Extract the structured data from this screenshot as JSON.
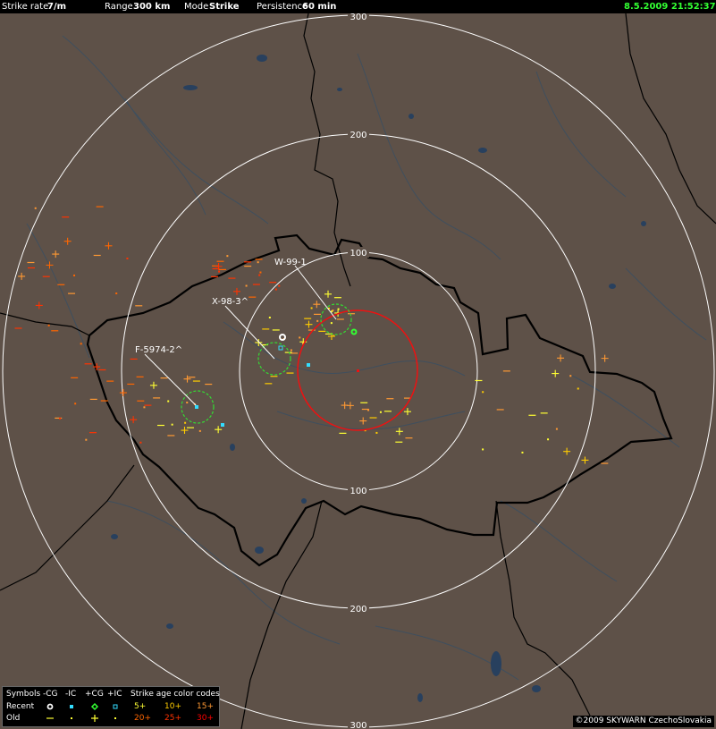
{
  "header": {
    "strike_rate_label": "Strike rate",
    "strike_rate_value": "7/m",
    "range_label": "Range",
    "range_value": "300 km",
    "mode_label": "Mode",
    "mode_value": "Strike",
    "persistence_label": "Persistence",
    "persistence_value": "60 min",
    "timestamp": "8.5.2009 21:52:37"
  },
  "rings": [
    {
      "label": "100"
    },
    {
      "label": "200"
    },
    {
      "label": "300"
    }
  ],
  "storms": [
    {
      "id": "W-99-1"
    },
    {
      "id": "X-98-3^"
    },
    {
      "id": "F-5974-2^"
    }
  ],
  "legend": {
    "symbols_label": "Symbols",
    "col_neg_cg": "-CG",
    "col_neg_ic": "-IC",
    "col_pos_cg": "+CG",
    "col_pos_ic": "+IC",
    "age_title": "Strike age color codes",
    "recent_label": "Recent",
    "old_label": "Old",
    "age_codes": [
      "5+",
      "10+",
      "15+",
      "20+",
      "25+",
      "30+"
    ],
    "age_colors": [
      "#ffff33",
      "#ffcc00",
      "#ff9933",
      "#ff6600",
      "#ff3300",
      "#ff0000"
    ]
  },
  "copyright": "©2009 SKYWARN CzechoSlovakia",
  "colors": {
    "background": "#5e5148",
    "ring": "#ffffff",
    "border": "#000000",
    "water": "#28405e",
    "red_circle": "#ee1111",
    "storm_cell": "#33dd33",
    "recent_ic": "#33ddff"
  }
}
